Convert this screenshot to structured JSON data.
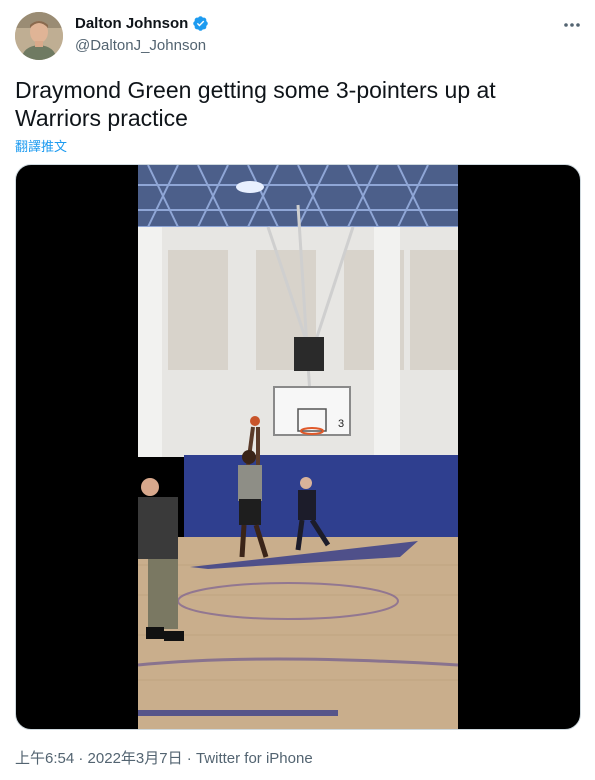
{
  "author": {
    "name": "Dalton Johnson",
    "handle": "@DaltonJ_Johnson",
    "verified": true,
    "avatar_icon": "profile-photo"
  },
  "tweet": {
    "text": "Draymond Green getting some 3-pointers up at Warriors practice",
    "translate_label": "翻譯推文",
    "media_type": "video"
  },
  "media": {
    "backboard_number": "3"
  },
  "meta": {
    "time": "上午6:54",
    "separator": " · ",
    "date": "2022年3月7日",
    "source": "Twitter for iPhone"
  },
  "colors": {
    "accent": "#1d9bf0",
    "text": "#0f1419",
    "secondary": "#536471"
  }
}
